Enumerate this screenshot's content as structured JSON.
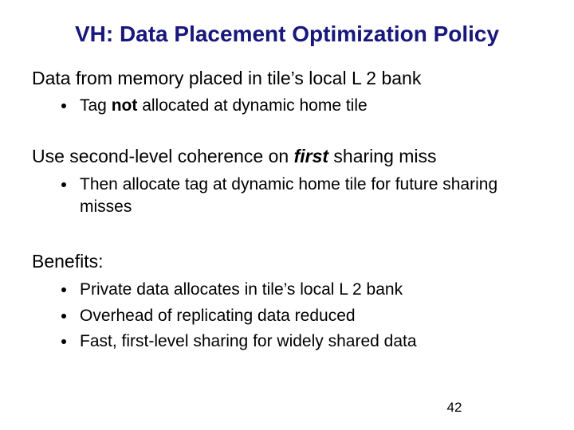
{
  "title": "VH: Data Placement Optimization Policy",
  "block1": {
    "line": "Data from memory placed in tile’s local L 2 bank",
    "sub1_pre": "Tag ",
    "sub1_bold": "not",
    "sub1_post": " allocated at dynamic home tile"
  },
  "block2": {
    "line_pre": "Use second-level coherence on ",
    "line_boldit": "first",
    "line_post": " sharing miss",
    "sub1": "Then allocate tag at dynamic home tile for future sharing misses"
  },
  "block3": {
    "line": "Benefits:",
    "sub1": "Private data allocates in tile’s local L 2 bank",
    "sub2": "Overhead of replicating data reduced",
    "sub3": "Fast, first-level sharing for widely shared data"
  },
  "page_number": "42"
}
